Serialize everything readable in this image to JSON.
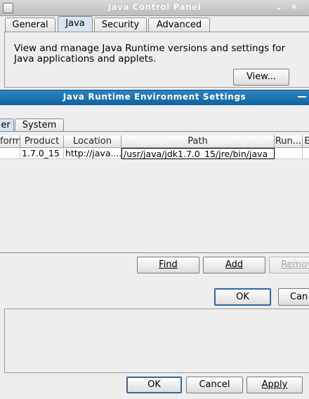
{
  "control_panel": {
    "title": "Java Control Panel",
    "window_controls": [
      "⌄",
      "✕"
    ],
    "tabs": [
      "General",
      "Java",
      "Security",
      "Advanced"
    ],
    "selected_tab": "Java",
    "description": "View and manage Java Runtime versions and settings for Java applications and applets.",
    "view_button": "View...",
    "buttons": {
      "ok": "OK",
      "cancel": "Cancel",
      "apply": "Apply"
    }
  },
  "jre_dialog": {
    "title": "Java Runtime Environment Settings",
    "tabs": [
      "er",
      "System"
    ],
    "columns": [
      "form",
      "Product",
      "Location",
      "Path",
      "Run...",
      "E"
    ],
    "rows": [
      {
        "platform": "",
        "product": "1.7.0_15",
        "location": "http://java....",
        "path": "/usr/java/jdk1.7.0_15/jre/bin/java",
        "runtime": "",
        "extra": ""
      }
    ],
    "find_button": "Find",
    "add_button": "Add",
    "remove_button": "Remov",
    "ok_button": "OK",
    "cancel_button": "Can"
  }
}
